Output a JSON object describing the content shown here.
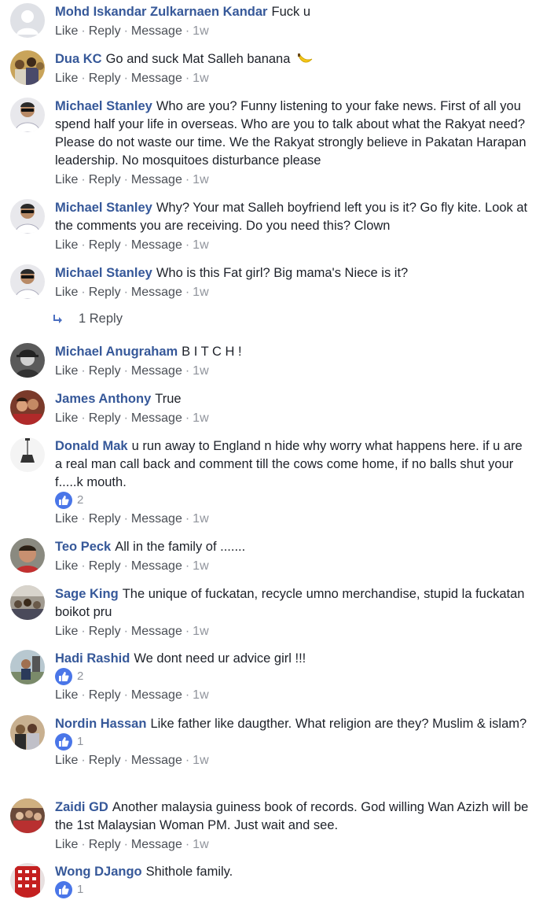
{
  "actions": {
    "like": "Like",
    "reply": "Reply",
    "message": "Message",
    "sep": "·"
  },
  "colors": {
    "author": "#365899",
    "meta": "#90949c",
    "like_badge": "#4a76e8"
  },
  "comments": [
    {
      "author": "Mohd Iskandar Zulkarnaen Kandar",
      "text": "Fuck u",
      "time": "1w",
      "avatar_icon": "default-avatar-icon"
    },
    {
      "author": "Dua KC",
      "text": "Go and suck Mat Salleh banana",
      "emoji": "banana-icon",
      "time": "1w",
      "avatar_icon": "group-photo-avatar"
    },
    {
      "author": "Michael Stanley",
      "text": "Who are you? Funny listening to your fake news. First of all you spend half your life in overseas. Who are you to talk about what the Rakyat need? Please do not waste our time. We the Rakyat strongly believe in Pakatan Harapan leadership. No mosquitoes disturbance please",
      "time": "1w",
      "avatar_icon": "sunglasses-man-avatar"
    },
    {
      "author": "Michael Stanley",
      "text": "Why? Your mat Salleh boyfriend left you is it? Go fly kite. Look at the comments you are receiving. Do you need this? Clown",
      "time": "1w",
      "avatar_icon": "sunglasses-man-avatar"
    },
    {
      "author": "Michael Stanley",
      "text": "Who is this Fat girl? Big mama's Niece is it?",
      "time": "1w",
      "avatar_icon": "sunglasses-man-avatar",
      "replies_label": "1 Reply"
    },
    {
      "author": "Michael Anugraham",
      "text": "B I T C H !",
      "time": "1w",
      "avatar_icon": "cap-man-avatar"
    },
    {
      "author": "James Anthony",
      "text": "True",
      "time": "1w",
      "avatar_icon": "couple-photo-avatar"
    },
    {
      "author": "Donald Mak",
      "text": "u run away to England n hide why worry what happens here. if u are a real man call back and comment till the cows come home, if no balls shut your f.....k mouth.",
      "time": "1w",
      "likes": "2",
      "avatar_icon": "lamp-avatar"
    },
    {
      "author": "Teo Peck",
      "text": "All in the family of .......",
      "time": "1w",
      "avatar_icon": "man-portrait-avatar"
    },
    {
      "author": "Sage King",
      "text": "The unique of fuckatan, recycle umno merchandise, stupid la fuckatan boikot pru",
      "time": "1w",
      "avatar_icon": "crowd-photo-avatar"
    },
    {
      "author": "Hadi Rashid",
      "text": "We dont need ur advice girl !!!",
      "time": "1w",
      "likes": "2",
      "avatar_icon": "outdoor-man-avatar"
    },
    {
      "author": "Nordin Hassan",
      "text": "Like father like daugther. What religion are they? Muslim & islam?",
      "time": "1w",
      "likes": "1",
      "avatar_icon": "family-photo-avatar"
    },
    {
      "author": "Zaidi GD",
      "text": "Another malaysia guiness book of records. God willing Wan Azizh will be the 1st Malaysian Woman PM. Just wait and see.",
      "time": "1w",
      "avatar_icon": "group-event-avatar"
    },
    {
      "author": "Wong DJango",
      "text": "Shithole family.",
      "likes": "1",
      "avatar_icon": "red-building-avatar"
    }
  ]
}
